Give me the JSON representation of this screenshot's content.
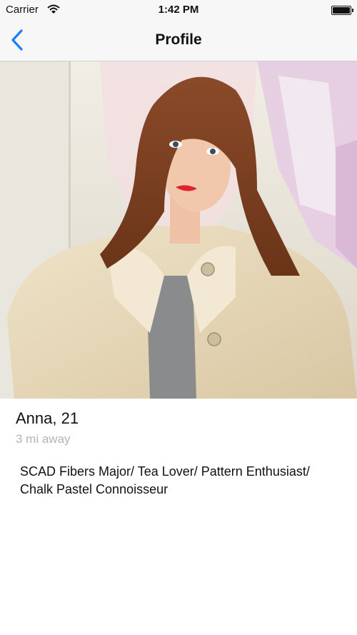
{
  "status_bar": {
    "carrier": "Carrier",
    "time": "1:42 PM"
  },
  "nav": {
    "title": "Profile",
    "back_icon": "chevron-left-icon",
    "accent_color": "#1a7ff5"
  },
  "profile": {
    "name_age": "Anna, 21",
    "distance": "3 mi away",
    "bio": "SCAD Fibers Major/ Tea Lover/ Pattern Enthusiast/ Chalk Pastel Connoisseur"
  }
}
